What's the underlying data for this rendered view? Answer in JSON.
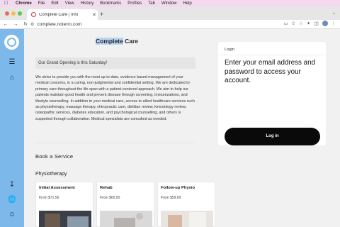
{
  "menubar": {
    "items": [
      "Chrome",
      "File",
      "Edit",
      "View",
      "History",
      "Bookmarks",
      "Profiles",
      "Tab",
      "Window",
      "Help"
    ]
  },
  "browser": {
    "tab_title": "Complete Care | Info",
    "url": "complete.noterro.com"
  },
  "site": {
    "title_part1": "Complete",
    "title_part2": " Care",
    "announcement": "Our Grand Opening is this Saturday!",
    "about": "We strive to provide you with the most up-to-date, evidence based management of your medical concerns, in a caring, non-judgmental and confidential setting. We are dedicated to primary care throughout the life span with a patient-centered approach. We aim to help our patients maintain good health and prevent disease through screening, immunizations, and lifestyle counselling. In addition to your medical care, access to allied healthcare services such as physiotherapy, massage therapy, chiropractic care, dietitian review, kinesiology review, osteopathic services, diabetes education, and psychological counselling, and others is supported through collaboration. Medical specialists are consulted as needed.",
    "book_heading": "Book a Service",
    "category": "Physiotherapy",
    "services": [
      {
        "title": "Initial Assessment",
        "price": "From $71.56"
      },
      {
        "title": "Rehab",
        "price": "From $65.00"
      },
      {
        "title": "Follow-up Physio",
        "price": "From $59.00"
      }
    ]
  },
  "login": {
    "label": "Login",
    "heading": "Enter your email address and password to access your account.",
    "button": "Log in"
  },
  "colors": {
    "sidebar": "#7db8ea",
    "menubar": "#f2d9ee",
    "button": "#0a0a0a"
  }
}
